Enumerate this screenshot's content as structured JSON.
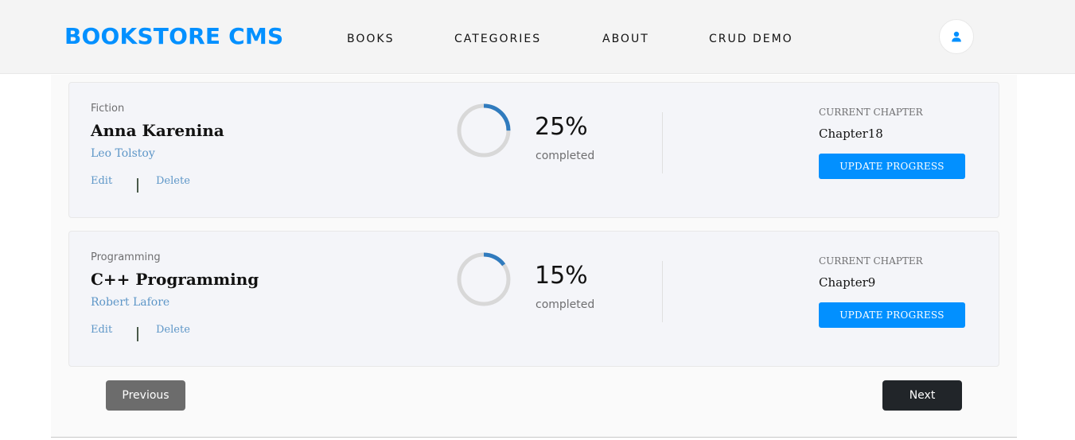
{
  "header": {
    "brand": "BOOKSTORE CMS",
    "nav": [
      "BOOKS",
      "CATEGORIES",
      "ABOUT",
      "CRUD DEMO"
    ],
    "avatar_icon": "user-icon"
  },
  "books": [
    {
      "category": "Fiction",
      "title": "Anna Karenina",
      "author": "Leo Tolstoy",
      "edit_label": "Edit",
      "delete_label": "Delete",
      "progress": 25,
      "percent_label": "25%",
      "completed_label": "completed",
      "chapter_label": "CURRENT CHAPTER",
      "chapter": "Chapter18",
      "update_label": "UPDATE PROGRESS"
    },
    {
      "category": "Programming",
      "title": "C++ Programming",
      "author": "Robert Lafore",
      "edit_label": "Edit",
      "delete_label": "Delete",
      "progress": 15,
      "percent_label": "15%",
      "completed_label": "completed",
      "chapter_label": "CURRENT CHAPTER",
      "chapter": "Chapter9",
      "update_label": "UPDATE PROGRESS"
    }
  ],
  "pagination": {
    "previous_label": "Previous",
    "next_label": "Next"
  },
  "colors": {
    "accent": "#0290ff",
    "progress": "#307bbe",
    "ring_track": "#d8d8d8",
    "previous_bg": "#6c6c6c",
    "next_bg": "#212529"
  }
}
